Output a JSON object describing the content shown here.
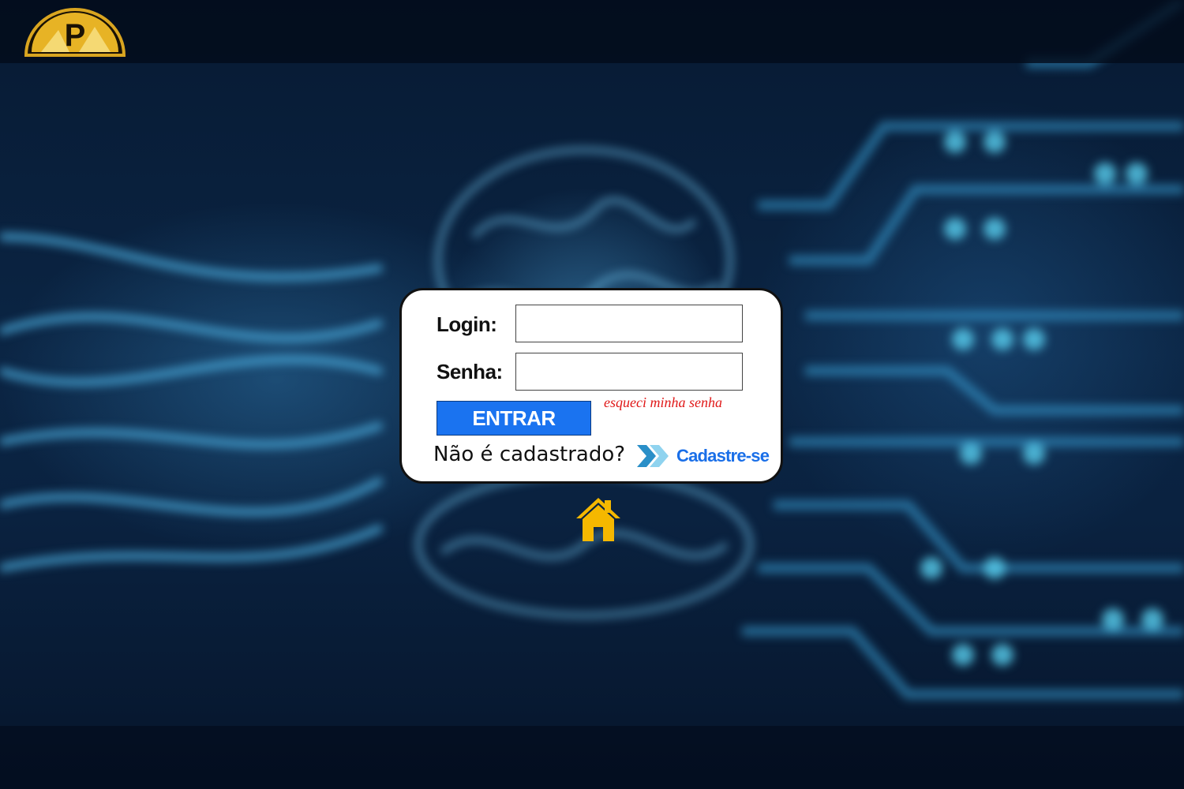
{
  "logo": {
    "letter": "P",
    "icon": "brand-logo-icon"
  },
  "form": {
    "login_label": "Login:",
    "login_value": "",
    "password_label": "Senha:",
    "password_value": "",
    "submit_label": "ENTRAR",
    "forgot_link": "esqueci minha senha",
    "not_registered_text": "Não é cadastrado?",
    "signup_link": "Cadastre-se"
  },
  "icons": {
    "chevrons": "double-chevron-right-icon",
    "home": "home-icon"
  },
  "colors": {
    "submit_bg": "#1a73f0",
    "forgot": "#e01818",
    "signup": "#1a6fe8",
    "home_icon": "#f5b800",
    "logo_gold": "#f2c12e"
  }
}
